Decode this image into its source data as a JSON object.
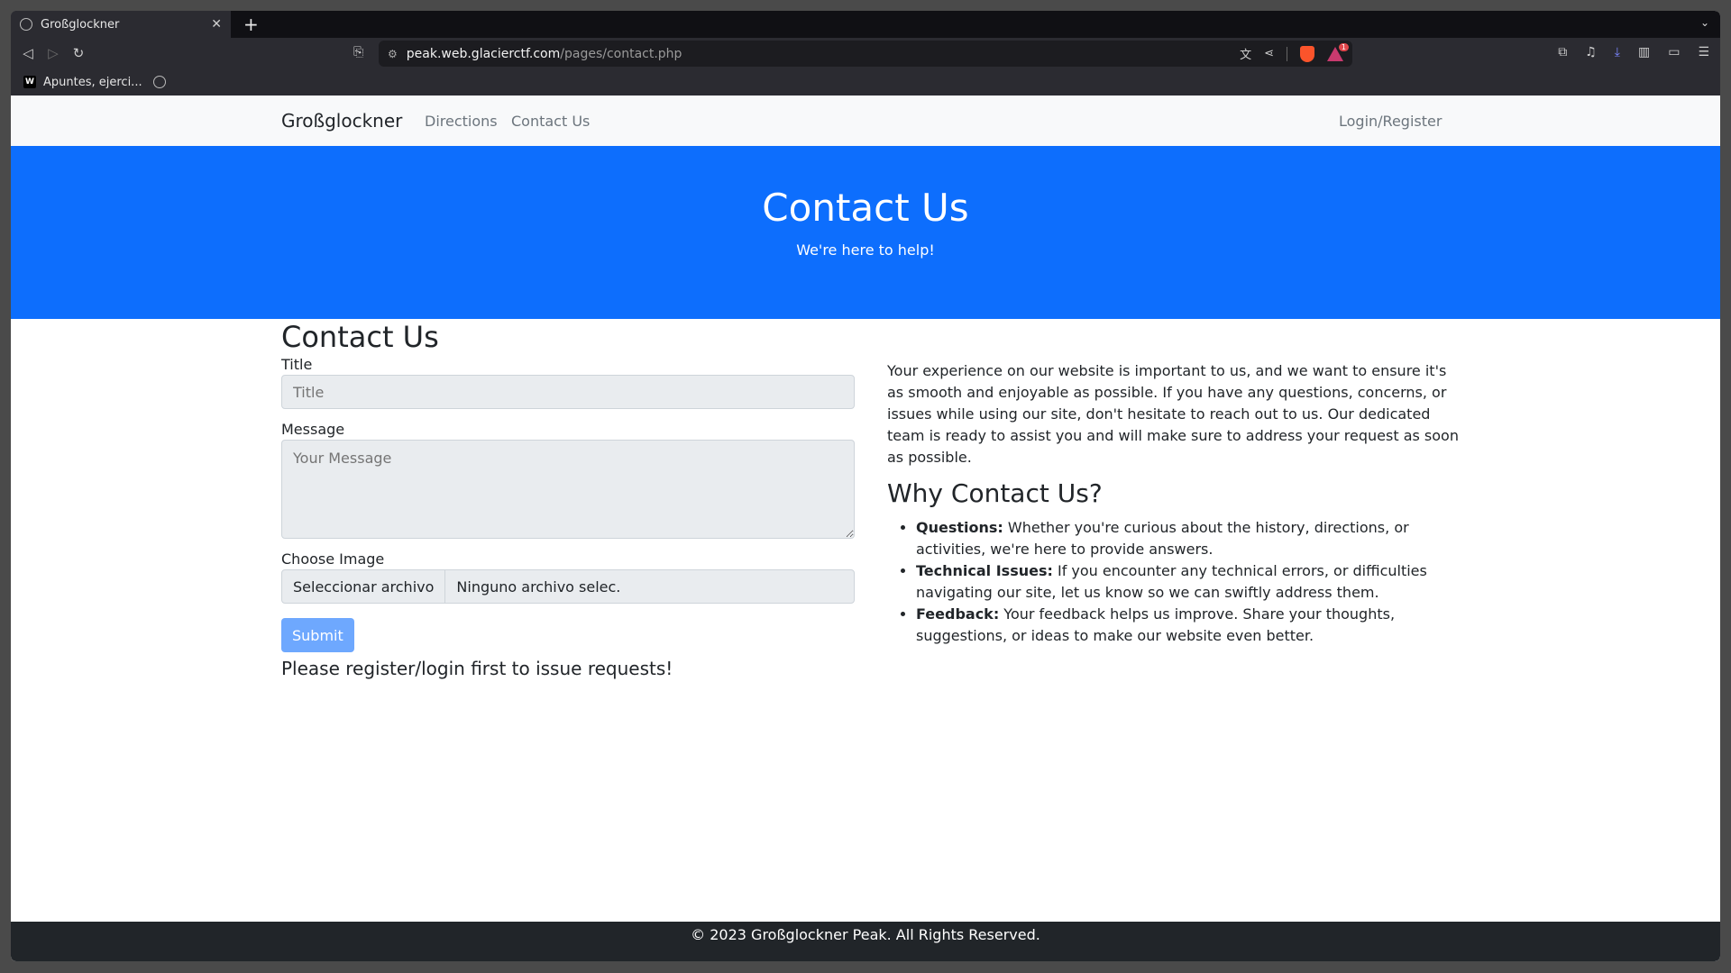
{
  "browser": {
    "tab": {
      "title": "Großglockner",
      "close": "✕"
    },
    "new_tab": "+",
    "tab_list": "⌄",
    "url": {
      "host": "peak.web.glacierctf.com",
      "path": "/pages/contact.php"
    },
    "rewards_badge": "1",
    "bookmarks": [
      {
        "favicon": "W",
        "label": "Apuntes, ejerci..."
      }
    ]
  },
  "site": {
    "brand": "Großglockner",
    "nav": {
      "directions": "Directions",
      "contact": "Contact Us",
      "login": "Login/Register"
    },
    "hero": {
      "title": "Contact Us",
      "subtitle": "We're here to help!"
    },
    "form": {
      "heading": "Contact Us",
      "title_label": "Title",
      "title_placeholder": "Title",
      "message_label": "Message",
      "message_placeholder": "Your Message",
      "image_label": "Choose Image",
      "file_button": "Seleccionar archivo",
      "file_status": "Ninguno archivo selec.",
      "submit": "Submit",
      "notice": "Please register/login first to issue requests!"
    },
    "info": {
      "paragraph": "Your experience on our website is important to us, and we want to ensure it's as smooth and enjoyable as possible. If you have any questions, concerns, or issues while using our site, don't hesitate to reach out to us. Our dedicated team is ready to assist you and will make sure to address your request as soon as possible.",
      "heading": "Why Contact Us?",
      "items": [
        {
          "term": "Questions:",
          "text": " Whether you're curious about the history, directions, or activities, we're here to provide answers."
        },
        {
          "term": "Technical Issues:",
          "text": " If you encounter any technical errors, or difficulties navigating our site, let us know so we can swiftly address them."
        },
        {
          "term": "Feedback:",
          "text": " Your feedback helps us improve. Share your thoughts, suggestions, or ideas to make our website even better."
        }
      ]
    },
    "footer": "© 2023 Großglockner Peak. All Rights Reserved."
  },
  "colors": {
    "primary": "#0d6efd",
    "footer": "#212529",
    "nav_bg": "#f8f9fa"
  }
}
